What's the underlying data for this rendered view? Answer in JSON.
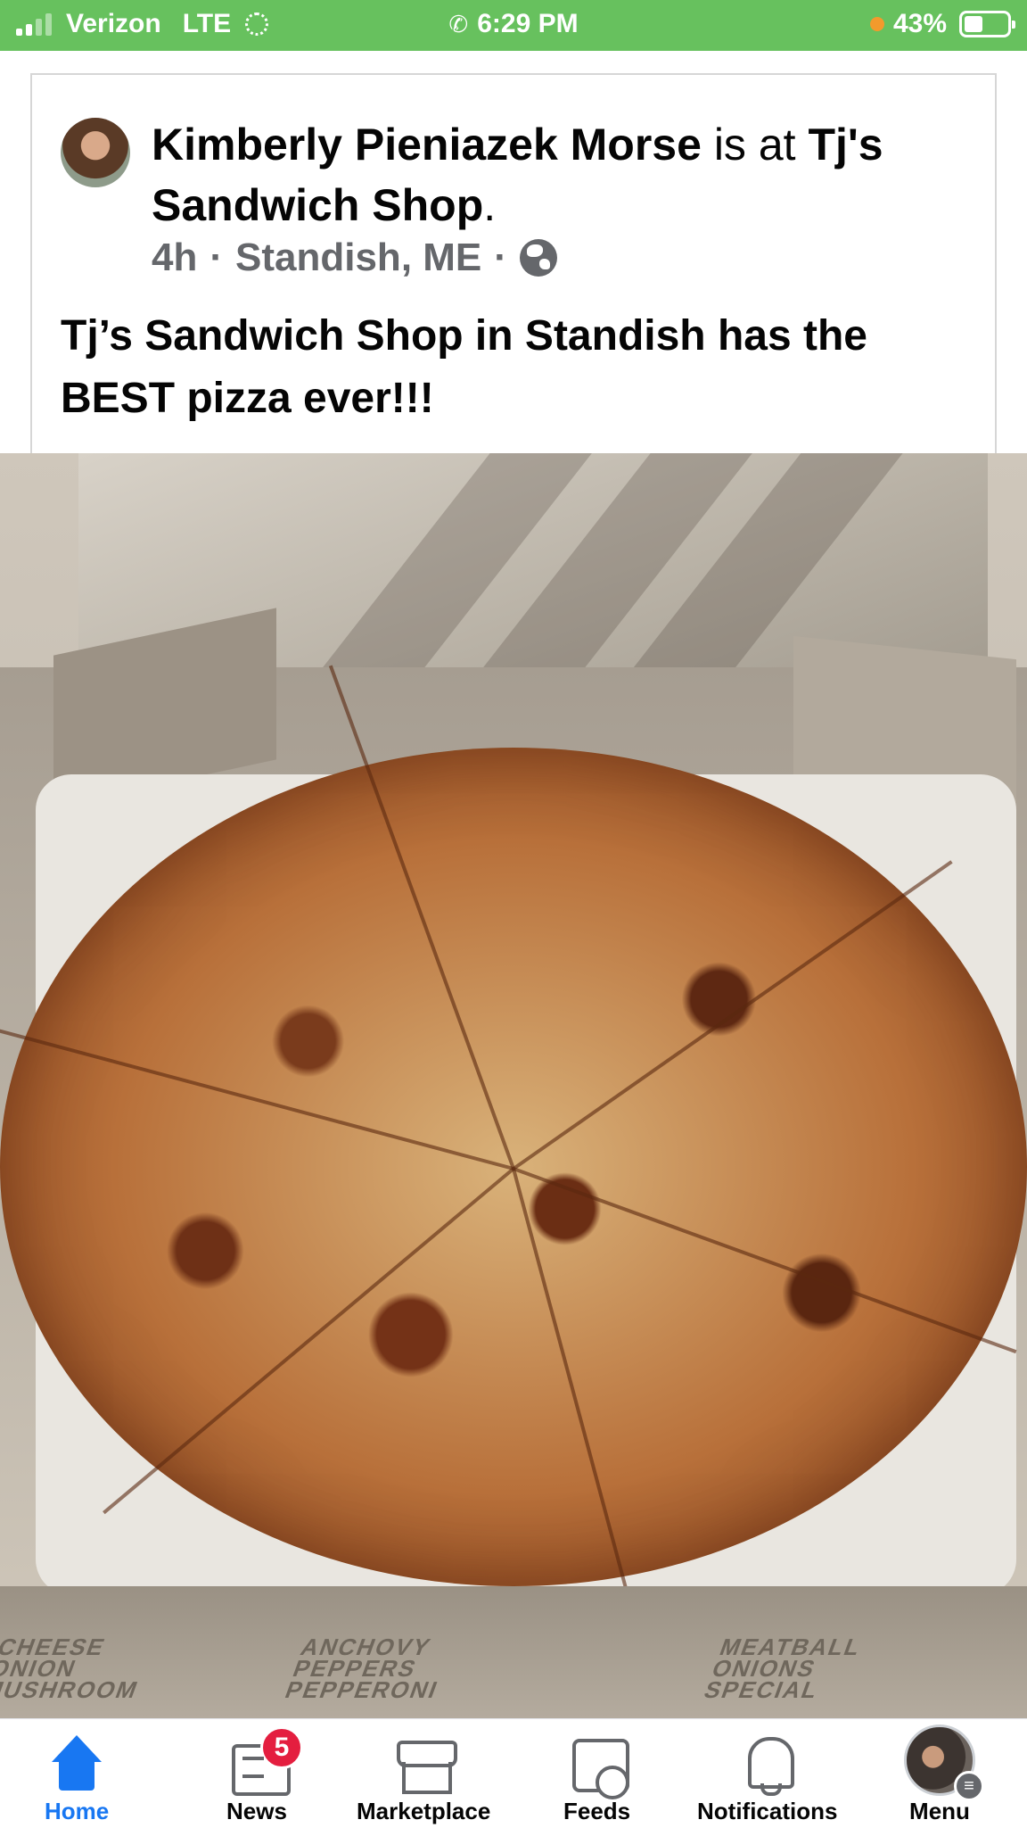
{
  "status_bar": {
    "carrier": "Verizon",
    "network": "LTE",
    "time": "6:29 PM",
    "battery": "43%",
    "battery_level": 0.43,
    "icons": [
      "signal-icon",
      "loading-icon",
      "phone-icon",
      "battery-icon"
    ]
  },
  "post": {
    "author": "Kimberly Pieniazek Morse",
    "is_at": "is at",
    "place": "Tj's Sandwich Shop",
    "period": ".",
    "time_ago": "4h",
    "separator": "·",
    "location": "Standish, ME",
    "privacy_icon": "globe-icon",
    "text": "Tj’s Sandwich Shop in Standish has the BEST pizza ever!!!"
  },
  "photo": {
    "box_print_left": "CHEESE\nONION\nMUSHROOM",
    "box_print_middle": "ANCHOVY\nPEPPERS\nPEPPERONI",
    "box_print_right": "MEATBALL\nONIONS\nSPECIAL"
  },
  "bottom_nav": {
    "items": [
      {
        "label": "Home",
        "icon": "home-icon",
        "active": true
      },
      {
        "label": "News",
        "icon": "news-icon",
        "badge": "5"
      },
      {
        "label": "Marketplace",
        "icon": "marketplace-icon"
      },
      {
        "label": "Feeds",
        "icon": "feeds-icon"
      },
      {
        "label": "Notifications",
        "icon": "bell-icon"
      },
      {
        "label": "Menu",
        "icon": "menu-avatar-icon"
      }
    ]
  },
  "colors": {
    "status_bar_bg": "#67c15e",
    "accent": "#1877f2",
    "badge": "#e41e3f",
    "secondary_text": "#65676b"
  }
}
